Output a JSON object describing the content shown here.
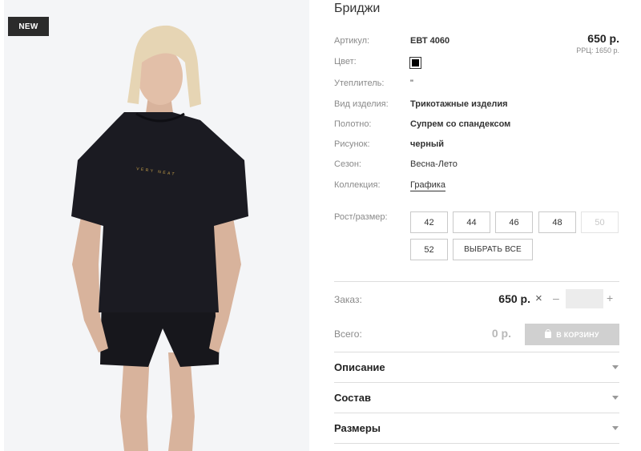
{
  "badge": {
    "new": "NEW"
  },
  "product": {
    "title": "Бриджи",
    "price": "650 р.",
    "rrp": "РРЦ: 1650 р.",
    "properties": {
      "article_label": "Артикул:",
      "article_value": "ЕВТ 4060",
      "color_label": "Цвет:",
      "color_value": "#000000",
      "insulation_label": "Утеплитель:",
      "insulation_value": "\"",
      "type_label": "Вид изделия:",
      "type_value": "Трикотажные изделия",
      "fabric_label": "Полотно:",
      "fabric_value": "Супрем со спандексом",
      "pattern_label": "Рисунок:",
      "pattern_value": "черный",
      "season_label": "Сезон:",
      "season_value": "Весна-Лето",
      "collection_label": "Коллекция:",
      "collection_value": "Графика"
    }
  },
  "sizes": {
    "label": "Рост/размер:",
    "items": [
      "42",
      "44",
      "46",
      "48",
      "50",
      "52"
    ],
    "disabled": [
      "50"
    ],
    "select_all": "ВЫБРАТЬ ВСЕ"
  },
  "order": {
    "label": "Заказ:",
    "price": "650 р.",
    "times": "×",
    "minus": "–",
    "plus": "+",
    "quantity": ""
  },
  "total": {
    "label": "Всего:",
    "value": "0 р.",
    "cart_button": "В КОРЗИНУ"
  },
  "accordion": {
    "description": "Описание",
    "composition": "Состав",
    "sizes": "Размеры"
  },
  "icons": {
    "cart": "shopping-bag-icon",
    "chevron": "chevron-down-icon"
  },
  "colors": {
    "badge_bg": "#2b2b2b",
    "cart_button_bg": "#d0d0d0",
    "divider": "#dddddd"
  }
}
